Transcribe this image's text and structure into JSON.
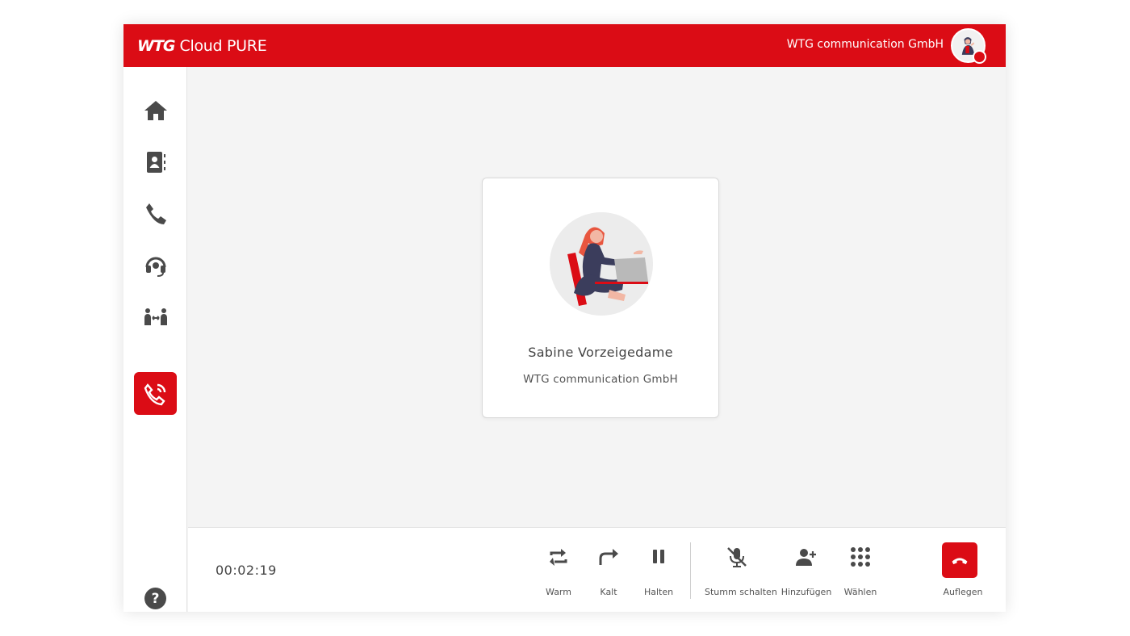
{
  "header": {
    "logo_mark": "WTG",
    "logo_product": "Cloud PURE",
    "organization": "WTG communication GmbH",
    "brand_color": "#db0c15"
  },
  "sidebar": {
    "items": [
      {
        "name": "home",
        "icon": "home-icon"
      },
      {
        "name": "contacts",
        "icon": "contacts-book-icon"
      },
      {
        "name": "phone",
        "icon": "phone-icon"
      },
      {
        "name": "headset",
        "icon": "headset-icon"
      },
      {
        "name": "transfer",
        "icon": "people-transfer-icon"
      },
      {
        "name": "active-call",
        "icon": "phone-ringing-icon",
        "active": true
      }
    ],
    "help_label": "?"
  },
  "contact": {
    "name": "Sabine Vorzeigedame",
    "company": "WTG communication GmbH"
  },
  "callbar": {
    "timer": "00:02:19",
    "actions": [
      {
        "label": "Warm",
        "icon": "warm-transfer-icon"
      },
      {
        "label": "Kalt",
        "icon": "cold-transfer-icon"
      },
      {
        "label": "Halten",
        "icon": "pause-icon"
      },
      {
        "label": "Stumm schalten",
        "icon": "mic-off-icon"
      },
      {
        "label": "Hinzufügen",
        "icon": "add-person-icon"
      },
      {
        "label": "Wählen",
        "icon": "dialpad-icon"
      },
      {
        "label": "Auflegen",
        "icon": "hang-up-icon"
      }
    ]
  }
}
